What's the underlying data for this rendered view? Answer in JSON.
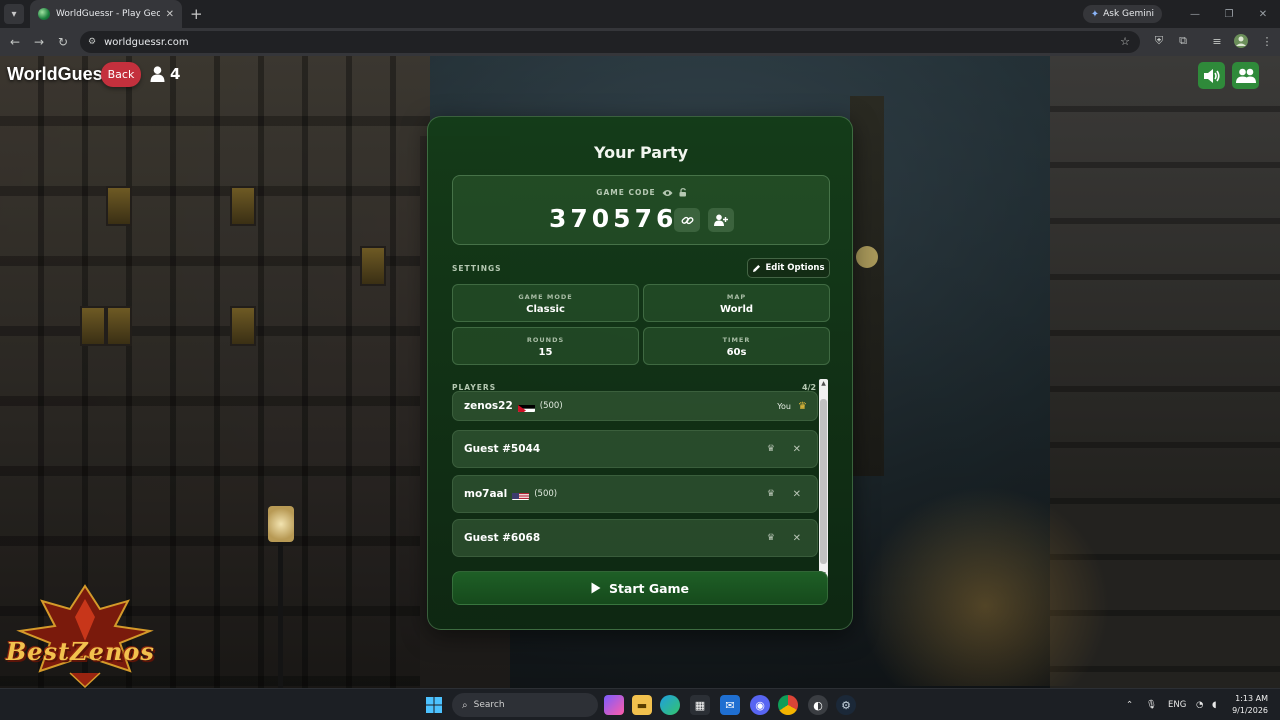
{
  "browser": {
    "tab_title": "WorldGuessr - Play GeoGuessr",
    "ask_gemini": "Ask Gemini",
    "url": "worldguessr.com"
  },
  "header": {
    "brand": "WorldGuessr",
    "back_label": "Back",
    "online_count": "4"
  },
  "party": {
    "title": "Your Party",
    "game_code_label": "GAME CODE",
    "game_code": "370576",
    "settings_label": "SETTINGS",
    "edit_options_label": "Edit Options",
    "settings": [
      {
        "label": "GAME MODE",
        "value": "Classic"
      },
      {
        "label": "MAP",
        "value": "World"
      },
      {
        "label": "ROUNDS",
        "value": "15"
      },
      {
        "label": "TIMER",
        "value": "60s"
      }
    ],
    "players_label": "PLAYERS",
    "players_count": "4/2",
    "players": [
      {
        "name": "zenos22",
        "flag": "jordan",
        "elo": "(500)",
        "you_label": "You"
      },
      {
        "name": "Guest #5044",
        "flag": "",
        "elo": ""
      },
      {
        "name": "mo7aal",
        "flag": "usa",
        "elo": "(500)"
      },
      {
        "name": "Guest #6068",
        "flag": "",
        "elo": ""
      }
    ],
    "start_label": "Start Game"
  },
  "logo": {
    "text": "BestZenos"
  },
  "taskbar": {
    "search_placeholder": "Search",
    "language": "ENG",
    "time": "1:13 AM",
    "date": "9/1/2026"
  },
  "colors": {
    "panel_bg": "#16421b",
    "accent_green": "#2f8a3a",
    "back_red": "#c4303d",
    "crown_gold": "#f3c43b"
  }
}
